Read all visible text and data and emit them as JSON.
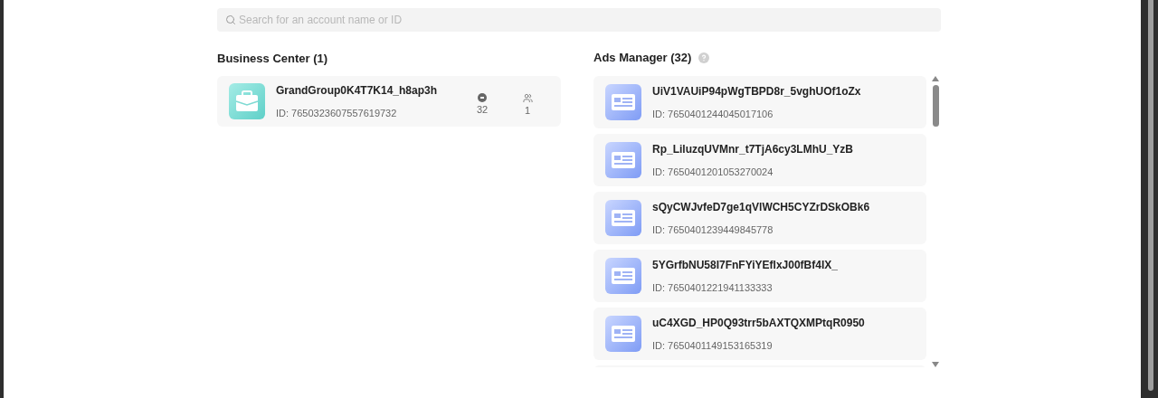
{
  "search": {
    "placeholder": "Search for an account name or ID"
  },
  "business_center": {
    "title": "Business Center (1)",
    "items": [
      {
        "name": "GrandGroup0K4T7K14_h8ap3h",
        "id": "ID: 7650323607557619732",
        "ad_accounts": "32",
        "members": "1"
      }
    ]
  },
  "ads_manager": {
    "title": "Ads Manager (32)",
    "items": [
      {
        "name": "UiV1VAUiP94pWgTBPD8r_5vghUOf1oZx",
        "id": "ID: 7650401244045017106"
      },
      {
        "name": "Rp_LiluzqUVMnr_t7TjA6cy3LMhU_YzB",
        "id": "ID: 7650401201053270024"
      },
      {
        "name": "sQyCWJvfeD7ge1qVlWCH5CYZrDSkOBk6",
        "id": "ID: 7650401239449845778"
      },
      {
        "name": "5YGrfbNU58I7FnFYiYEflxJ00fBf4IX_",
        "id": "ID: 7650401221941133333"
      },
      {
        "name": "uC4XGD_HP0Q93trr5bAXTQXMPtqR0950",
        "id": "ID: 7650401149153165319"
      }
    ]
  }
}
